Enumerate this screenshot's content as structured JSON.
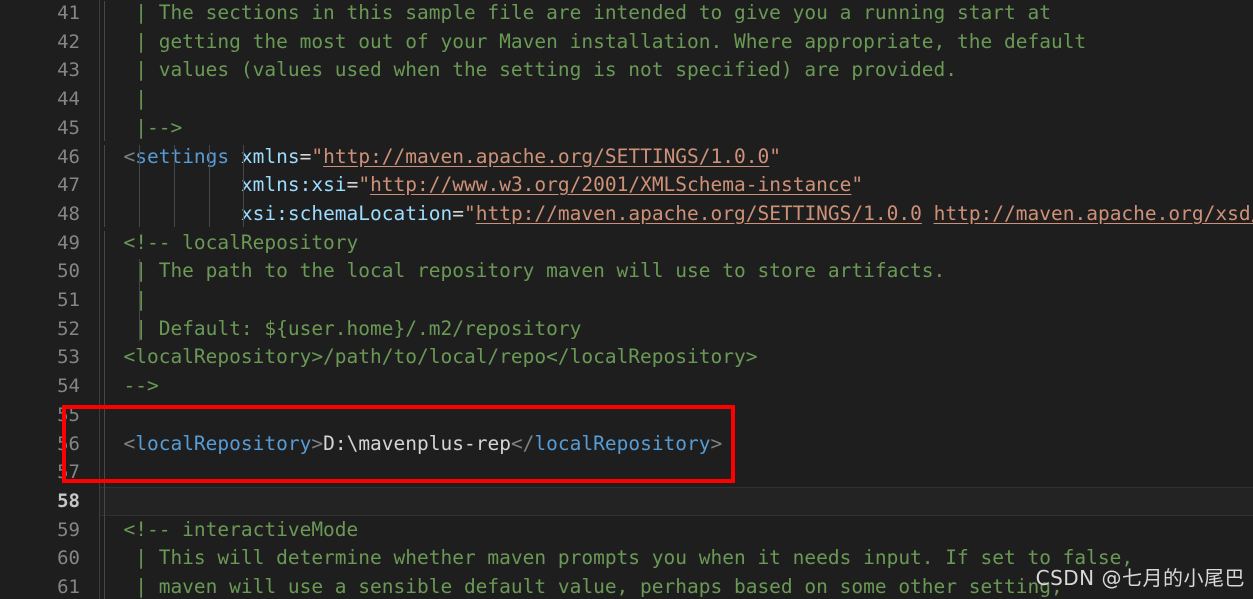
{
  "editor": {
    "theme": "dark",
    "language": "xml",
    "file_description": "maven settings.xml",
    "first_visible_line": 41,
    "active_line": 58,
    "colors": {
      "background": "#1e1e1e",
      "gutter_text": "#858585",
      "active_line_number": "#c6c6c6",
      "comment": "#6a9955",
      "tag_name": "#569cd6",
      "tag_bracket": "#808080",
      "attribute_name": "#9cdcfe",
      "attribute_value": "#ce9178",
      "plain_text": "#d4d4d4",
      "indent_guide": "#474747",
      "annotation_red": "#ff0000"
    }
  },
  "annotation": {
    "name": "red-highlight-rectangle",
    "covers_lines": "55-57",
    "color": "#ff0000"
  },
  "watermark": {
    "text": "CSDN @七月的小尾巴"
  },
  "lines": [
    {
      "number": "41",
      "tokens": [
        {
          "cls": "cmt",
          "t": "   | The sections in this sample file are intended to give you a running start at"
        }
      ]
    },
    {
      "number": "42",
      "tokens": [
        {
          "cls": "cmt",
          "t": "   | getting the most out of your Maven installation. Where appropriate, the default"
        }
      ]
    },
    {
      "number": "43",
      "tokens": [
        {
          "cls": "cmt",
          "t": "   | values (values used when the setting is not specified) are provided."
        }
      ]
    },
    {
      "number": "44",
      "tokens": [
        {
          "cls": "cmt",
          "t": "   |"
        }
      ]
    },
    {
      "number": "45",
      "tokens": [
        {
          "cls": "cmt",
          "t": "   |-->"
        }
      ]
    },
    {
      "number": "46",
      "tokens": [
        {
          "cls": "tagb",
          "t": "  <"
        },
        {
          "cls": "tag",
          "t": "settings"
        },
        {
          "cls": "txt",
          "t": " "
        },
        {
          "cls": "attr",
          "t": "xmlns"
        },
        {
          "cls": "eq",
          "t": "="
        },
        {
          "cls": "str",
          "t": "\""
        },
        {
          "cls": "link",
          "t": "http://maven.apache.org/SETTINGS/1.0.0"
        },
        {
          "cls": "str",
          "t": "\""
        }
      ]
    },
    {
      "number": "47",
      "tokens": [
        {
          "cls": "txt",
          "t": "            "
        },
        {
          "cls": "attr",
          "t": "xmlns:xsi"
        },
        {
          "cls": "eq",
          "t": "="
        },
        {
          "cls": "str",
          "t": "\""
        },
        {
          "cls": "link",
          "t": "http://www.w3.org/2001/XMLSchema-instance"
        },
        {
          "cls": "str",
          "t": "\""
        }
      ]
    },
    {
      "number": "48",
      "tokens": [
        {
          "cls": "txt",
          "t": "            "
        },
        {
          "cls": "attr",
          "t": "xsi:schemaLocation"
        },
        {
          "cls": "eq",
          "t": "="
        },
        {
          "cls": "str",
          "t": "\""
        },
        {
          "cls": "link",
          "t": "http://maven.apache.org/SETTINGS/1.0.0"
        },
        {
          "cls": "str",
          "t": " "
        },
        {
          "cls": "link",
          "t": "http://maven.apache.org/xsd/set"
        }
      ]
    },
    {
      "number": "49",
      "tokens": [
        {
          "cls": "cmt",
          "t": "  <!-- localRepository"
        }
      ]
    },
    {
      "number": "50",
      "tokens": [
        {
          "cls": "cmt",
          "t": "   | The path to the local repository maven will use to store artifacts."
        }
      ]
    },
    {
      "number": "51",
      "tokens": [
        {
          "cls": "cmt",
          "t": "   |"
        }
      ]
    },
    {
      "number": "52",
      "tokens": [
        {
          "cls": "cmt",
          "t": "   | Default: ${user.home}/.m2/repository"
        }
      ]
    },
    {
      "number": "53",
      "tokens": [
        {
          "cls": "cmt",
          "t": "  <localRepository>/path/to/local/repo</localRepository>"
        }
      ]
    },
    {
      "number": "54",
      "tokens": [
        {
          "cls": "cmt",
          "t": "  -->"
        }
      ]
    },
    {
      "number": "55",
      "tokens": [
        {
          "cls": "txt",
          "t": ""
        }
      ]
    },
    {
      "number": "56",
      "tokens": [
        {
          "cls": "tagb",
          "t": "  <"
        },
        {
          "cls": "tag",
          "t": "localRepository"
        },
        {
          "cls": "tagb",
          "t": ">"
        },
        {
          "cls": "txt",
          "t": "D:\\mavenplus-rep"
        },
        {
          "cls": "tagb",
          "t": "</"
        },
        {
          "cls": "tag",
          "t": "localRepository"
        },
        {
          "cls": "tagb",
          "t": ">"
        }
      ]
    },
    {
      "number": "57",
      "tokens": [
        {
          "cls": "txt",
          "t": ""
        }
      ]
    },
    {
      "number": "58",
      "tokens": [
        {
          "cls": "txt",
          "t": ""
        }
      ]
    },
    {
      "number": "59",
      "tokens": [
        {
          "cls": "cmt",
          "t": "  <!-- interactiveMode"
        }
      ]
    },
    {
      "number": "60",
      "tokens": [
        {
          "cls": "cmt",
          "t": "   | This will determine whether maven prompts you when it needs input. If set to false,"
        }
      ]
    },
    {
      "number": "61",
      "tokens": [
        {
          "cls": "cmt",
          "t": "   | maven will use a sensible default value, perhaps based on some other setting,"
        }
      ]
    }
  ],
  "indent_guides": [
    {
      "line_start": 41,
      "line_end": 45,
      "col": 0
    },
    {
      "line_start": 46,
      "line_end": 48,
      "col": 0
    },
    {
      "line_start": 46,
      "line_end": 48,
      "col": 3
    },
    {
      "line_start": 46,
      "line_end": 48,
      "col": 6
    },
    {
      "line_start": 46,
      "line_end": 48,
      "col": 9
    },
    {
      "line_start": 46,
      "line_end": 48,
      "col": 12
    },
    {
      "line_start": 49,
      "line_end": 61,
      "col": 0
    },
    {
      "line_start": 50,
      "line_end": 52,
      "col": 3
    }
  ]
}
